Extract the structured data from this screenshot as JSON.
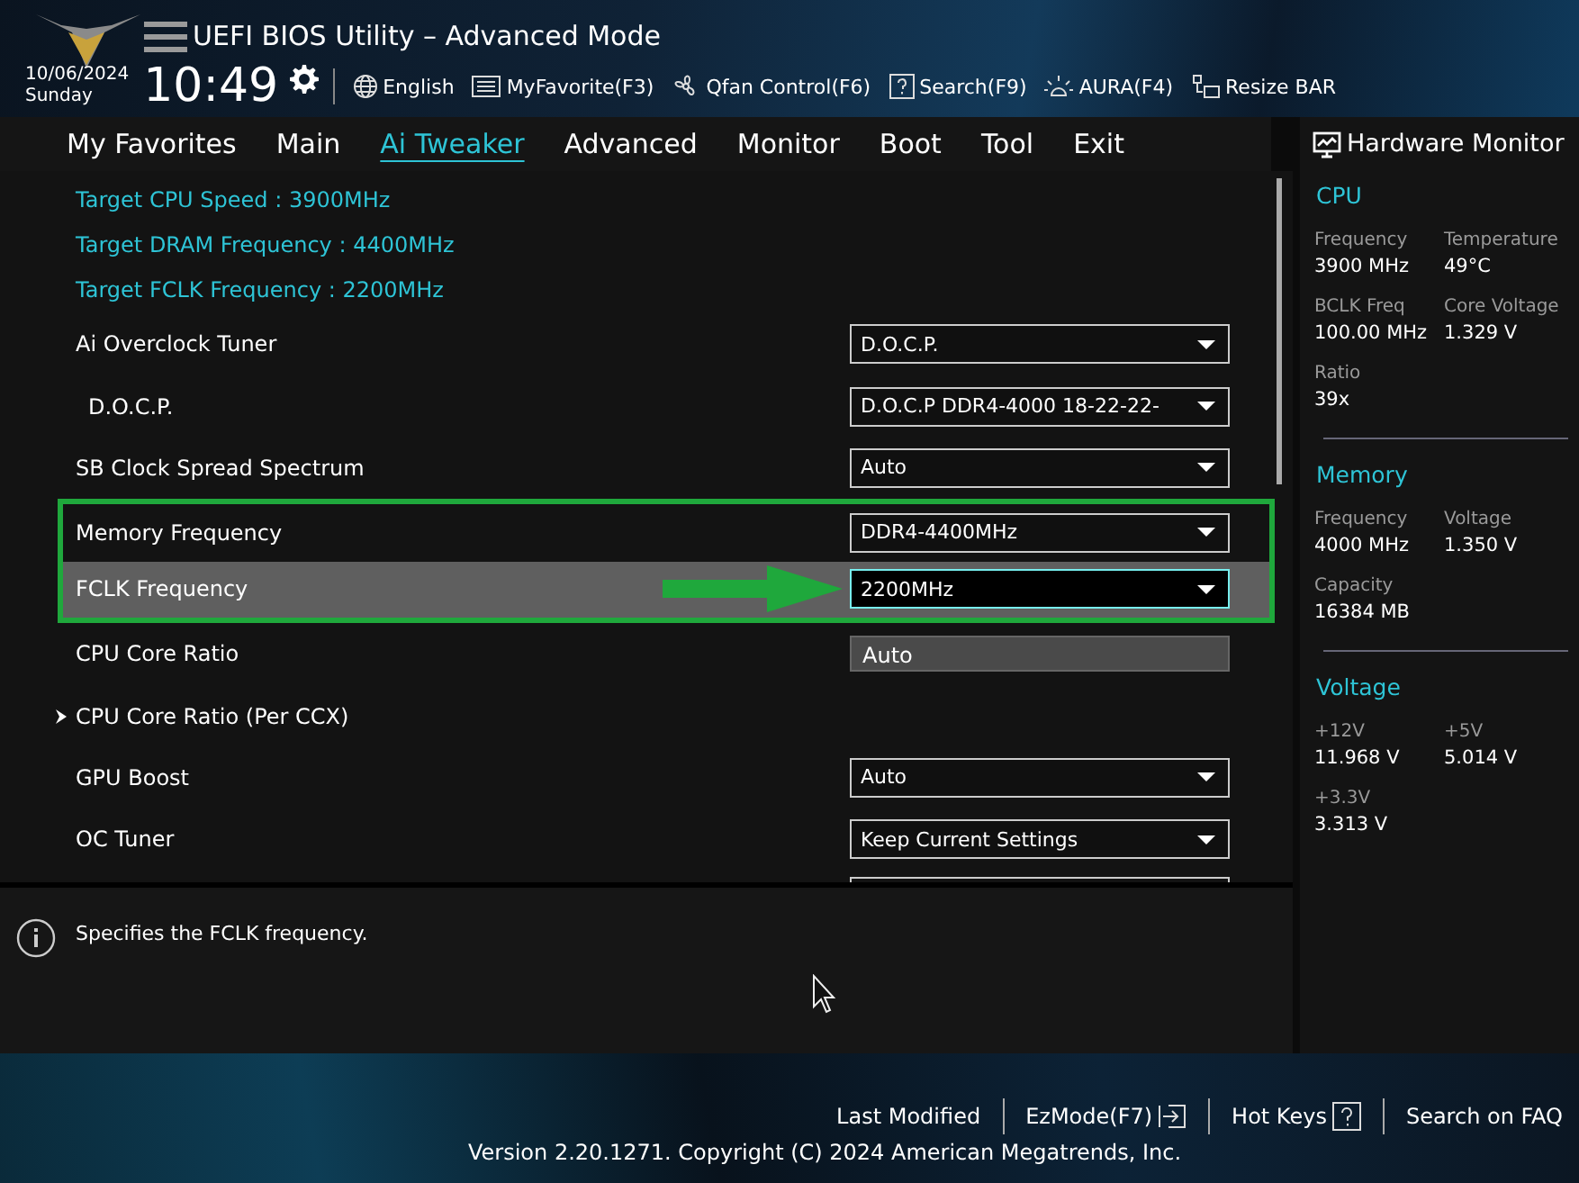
{
  "header": {
    "title": "UEFI BIOS Utility – Advanced Mode",
    "date": "10/06/2024",
    "day": "Sunday",
    "time": "10:49",
    "tools": [
      {
        "kind": "globe",
        "label": "English"
      },
      {
        "kind": "favorite",
        "label": "MyFavorite(F3)"
      },
      {
        "kind": "fan",
        "label": "Qfan Control(F6)"
      },
      {
        "kind": "search",
        "label": "Search(F9)"
      },
      {
        "kind": "aura",
        "label": "AURA(F4)"
      },
      {
        "kind": "resize",
        "label": "Resize BAR"
      }
    ]
  },
  "tabs": [
    {
      "label": "My Favorites",
      "selected": false
    },
    {
      "label": "Main",
      "selected": false
    },
    {
      "label": "Ai Tweaker",
      "selected": true
    },
    {
      "label": "Advanced",
      "selected": false
    },
    {
      "label": "Monitor",
      "selected": false
    },
    {
      "label": "Boot",
      "selected": false
    },
    {
      "label": "Tool",
      "selected": false
    },
    {
      "label": "Exit",
      "selected": false
    }
  ],
  "settings": [
    {
      "kind": "info",
      "label": "Target CPU Speed : 3900MHz"
    },
    {
      "kind": "info",
      "label": "Target DRAM Frequency : 4400MHz"
    },
    {
      "kind": "info",
      "label": "Target FCLK Frequency : 2200MHz"
    },
    {
      "kind": "dropdown",
      "label": "Ai Overclock Tuner",
      "value": "D.O.C.P.",
      "selected": false,
      "highlighted": false,
      "arrow": false
    },
    {
      "kind": "dropdown",
      "label": "D.O.C.P.",
      "value": "D.O.C.P DDR4-4000 18-22-22-",
      "indented": true,
      "selected": false,
      "highlighted": false,
      "arrow": false
    },
    {
      "kind": "dropdown",
      "label": "SB Clock Spread Spectrum",
      "value": "Auto",
      "selected": false,
      "highlighted": false,
      "arrow": false
    },
    {
      "kind": "dropdown",
      "label": "Memory Frequency",
      "value": "DDR4-4400MHz",
      "selected": false,
      "highlighted": true,
      "arrow": false
    },
    {
      "kind": "dropdown",
      "label": "FCLK Frequency",
      "value": "2200MHz",
      "selected": true,
      "highlighted": true,
      "arrow": true
    },
    {
      "kind": "readonly",
      "label": "CPU Core Ratio",
      "value": "Auto",
      "selected": false,
      "highlighted": false,
      "arrow": false
    },
    {
      "kind": "submenu",
      "label": "CPU Core Ratio (Per CCX)",
      "selected": false,
      "highlighted": false,
      "arrow": false
    },
    {
      "kind": "dropdown",
      "label": "GPU Boost",
      "value": "Auto",
      "selected": false,
      "highlighted": false,
      "arrow": false
    },
    {
      "kind": "dropdown",
      "label": "OC Tuner",
      "value": "Keep Current Settings",
      "selected": false,
      "highlighted": false,
      "arrow": false
    }
  ],
  "help": {
    "text": "Specifies the FCLK frequency."
  },
  "hardware_monitor": {
    "title": "Hardware Monitor",
    "sections": [
      {
        "title": "CPU",
        "items": [
          {
            "label": "Frequency",
            "value": "3900 MHz"
          },
          {
            "label": "Temperature",
            "value": "49°C"
          },
          {
            "label": "BCLK Freq",
            "value": "100.00 MHz"
          },
          {
            "label": "Core Voltage",
            "value": "1.329 V"
          },
          {
            "label": "Ratio",
            "value": "39x"
          }
        ]
      },
      {
        "title": "Memory",
        "items": [
          {
            "label": "Frequency",
            "value": "4000 MHz"
          },
          {
            "label": "Voltage",
            "value": "1.350 V"
          },
          {
            "label": "Capacity",
            "value": "16384 MB"
          }
        ]
      },
      {
        "title": "Voltage",
        "items": [
          {
            "label": "+12V",
            "value": "11.968 V"
          },
          {
            "label": "+5V",
            "value": "5.014 V"
          },
          {
            "label": "+3.3V",
            "value": "3.313 V"
          }
        ]
      }
    ]
  },
  "footer": {
    "links": [
      {
        "kind": "plain",
        "label": "Last Modified"
      },
      {
        "kind": "exit",
        "label": "EzMode(F7)"
      },
      {
        "kind": "help",
        "label": "Hot Keys"
      },
      {
        "kind": "plain",
        "label": "Search on FAQ"
      }
    ],
    "version": "Version 2.20.1271. Copyright (C) 2024 American Megatrends, Inc."
  }
}
